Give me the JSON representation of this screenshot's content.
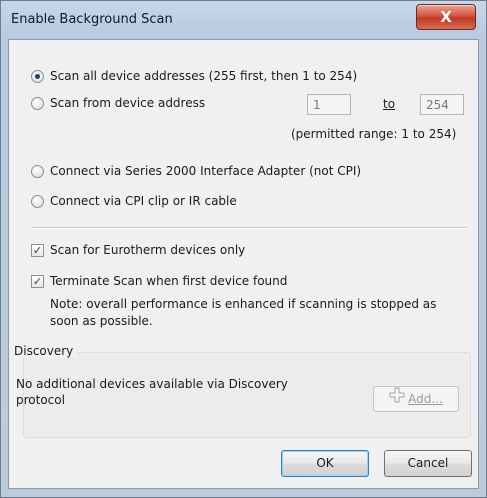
{
  "window": {
    "title": "Enable Background Scan",
    "close_glyph": "X"
  },
  "scan_mode": {
    "option_all": "Scan all device addresses (255 first, then 1 to 254)",
    "option_from": "Scan from device address",
    "from_value": "1",
    "to_label": "to",
    "to_value": "254",
    "range_note": "(permitted range: 1 to 254)",
    "option_series2000": "Connect via Series 2000 Interface Adapter (not CPI)",
    "option_cpi": "Connect via CPI clip or IR cable"
  },
  "options": {
    "eurotherm_only": "Scan for Eurotherm devices only",
    "terminate_on_first": "Terminate Scan when first device found",
    "note_line1": "Note: overall performance is enhanced if scanning is stopped as",
    "note_line2": "soon as possible.",
    "check_glyph": "✓"
  },
  "discovery": {
    "title": "Discovery",
    "message_line1": "No additional devices available via Discovery",
    "message_line2": "protocol",
    "add_button": "Add...",
    "add_icon": "plus-icon"
  },
  "buttons": {
    "ok": "OK",
    "cancel": "Cancel"
  },
  "colors": {
    "title_bar": "#c7d7ea",
    "close_button": "#c23b26",
    "dialog_background": "#f0f0f0",
    "selected_radio_dot": "#1d3f7a"
  }
}
